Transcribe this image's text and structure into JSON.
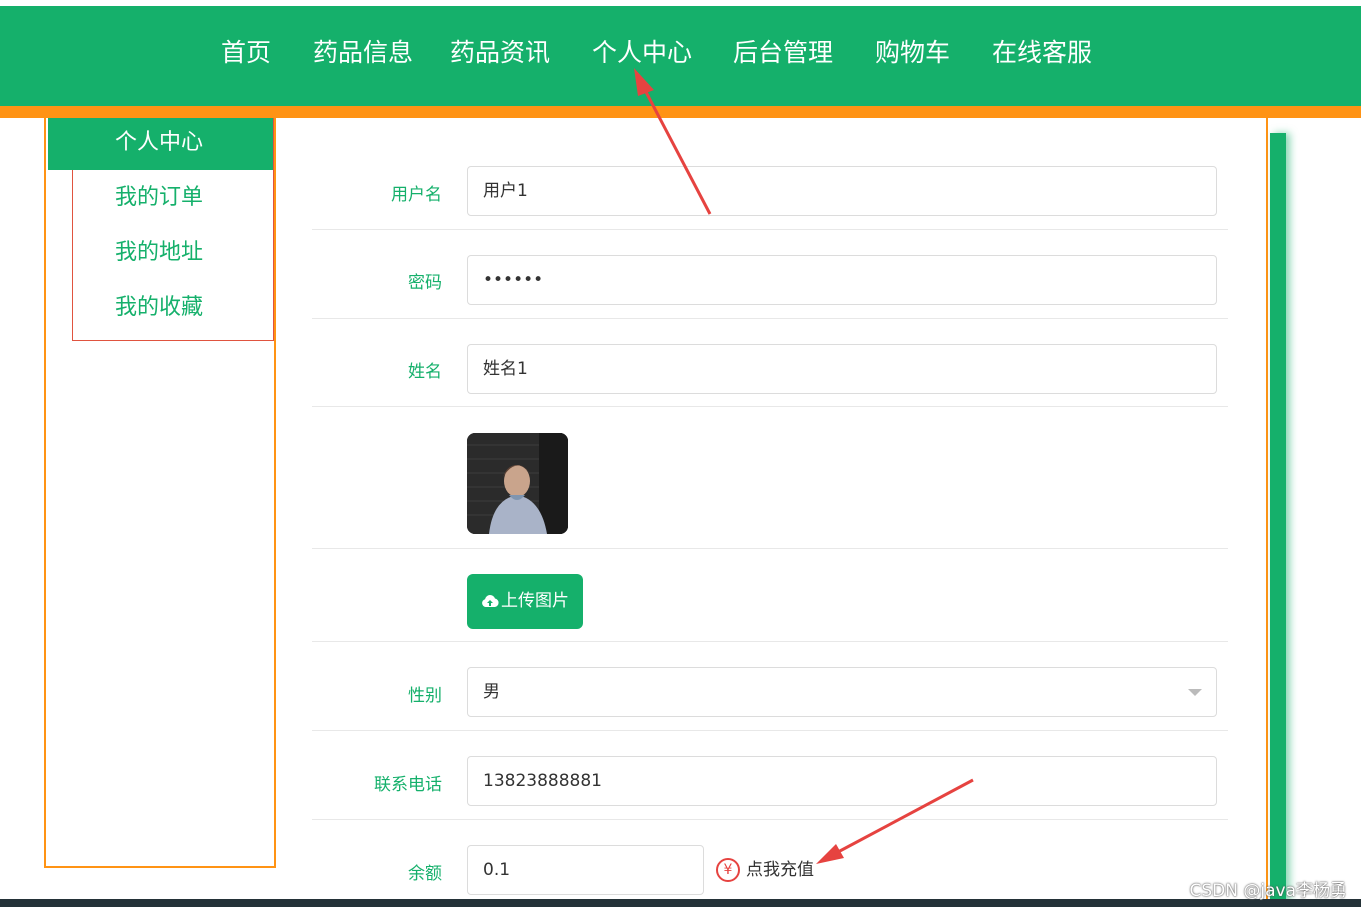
{
  "nav": {
    "items": [
      "首页",
      "药品信息",
      "药品资讯",
      "个人中心",
      "后台管理",
      "购物车",
      "在线客服"
    ]
  },
  "sidebar": {
    "items": [
      "个人中心",
      "我的订单",
      "我的地址",
      "我的收藏"
    ]
  },
  "form": {
    "username_label": "用户名",
    "username_value": "用户1",
    "password_label": "密码",
    "password_value": "••••••",
    "name_label": "姓名",
    "name_value": "姓名1",
    "upload_label": "上传图片",
    "gender_label": "性别",
    "gender_value": "男",
    "phone_label": "联系电话",
    "phone_value": "13823888881",
    "balance_label": "余额",
    "balance_value": "0.1",
    "recharge_label": "点我充值",
    "yen_symbol": "¥"
  },
  "watermark": "CSDN @java李杨勇",
  "colors": {
    "primary": "#15b06b",
    "accent": "#ff9314",
    "annotation": "#e64340"
  },
  "icons": [
    "cloud-upload-icon",
    "yen-icon",
    "chevron-down-icon"
  ]
}
